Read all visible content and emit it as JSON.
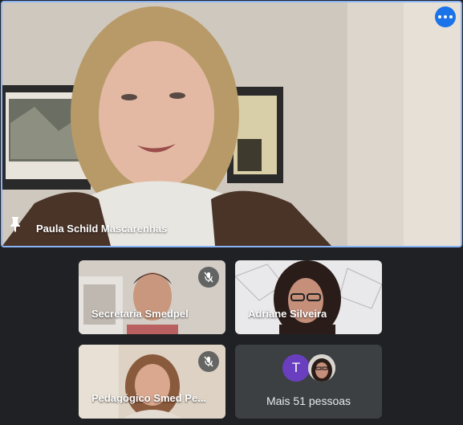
{
  "main": {
    "name": "Paula Schild Mascarenhas",
    "pin_icon": "pin-icon",
    "more_icon": "more-options-icon"
  },
  "tiles": [
    {
      "name": "Secretaria Smedpel",
      "muted": true
    },
    {
      "name": "Adriane Silveira",
      "muted": false
    },
    {
      "name": "Pedagógico Smed Pe...",
      "muted": true
    }
  ],
  "more": {
    "avatar_letter": "T",
    "label": "Mais 51 pessoas"
  },
  "colors": {
    "background": "#202124",
    "active_border": "#8ab4f8",
    "more_button": "#1a73e8",
    "avatar_t": "#6a3fbf",
    "tile": "#3c4043"
  }
}
